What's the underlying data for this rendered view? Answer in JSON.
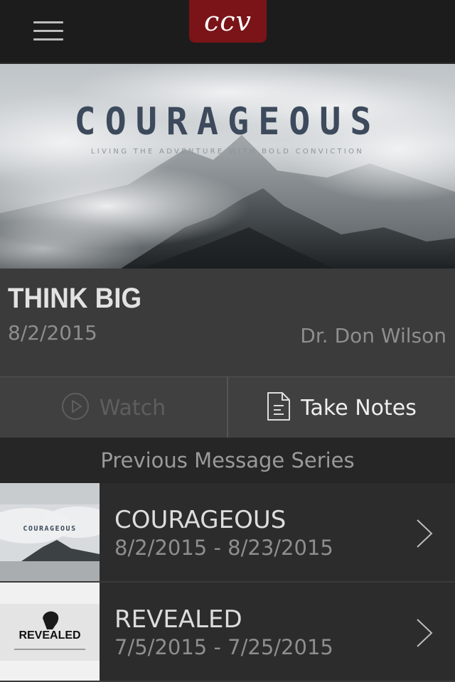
{
  "app": {
    "logo_text": "ccv",
    "accent_color": "#7a1418"
  },
  "hero": {
    "title": "COURAGEOUS",
    "subtitle": "LIVING THE ADVENTURE WITH BOLD CONVICTION"
  },
  "message": {
    "title": "THINK BIG",
    "date": "8/2/2015",
    "speaker": "Dr. Don Wilson"
  },
  "actions": {
    "watch_label": "Watch",
    "watch_icon": "play-circle-icon",
    "notes_label": "Take Notes",
    "notes_icon": "document-icon"
  },
  "previous": {
    "header": "Previous Message Series",
    "items": [
      {
        "name": "COURAGEOUS",
        "dates": "8/2/2015 - 8/23/2015",
        "thumb_text": "COURAGEOUS"
      },
      {
        "name": "REVEALED",
        "dates": "7/5/2015 - 7/25/2015",
        "thumb_text": "REVEALED"
      }
    ]
  }
}
